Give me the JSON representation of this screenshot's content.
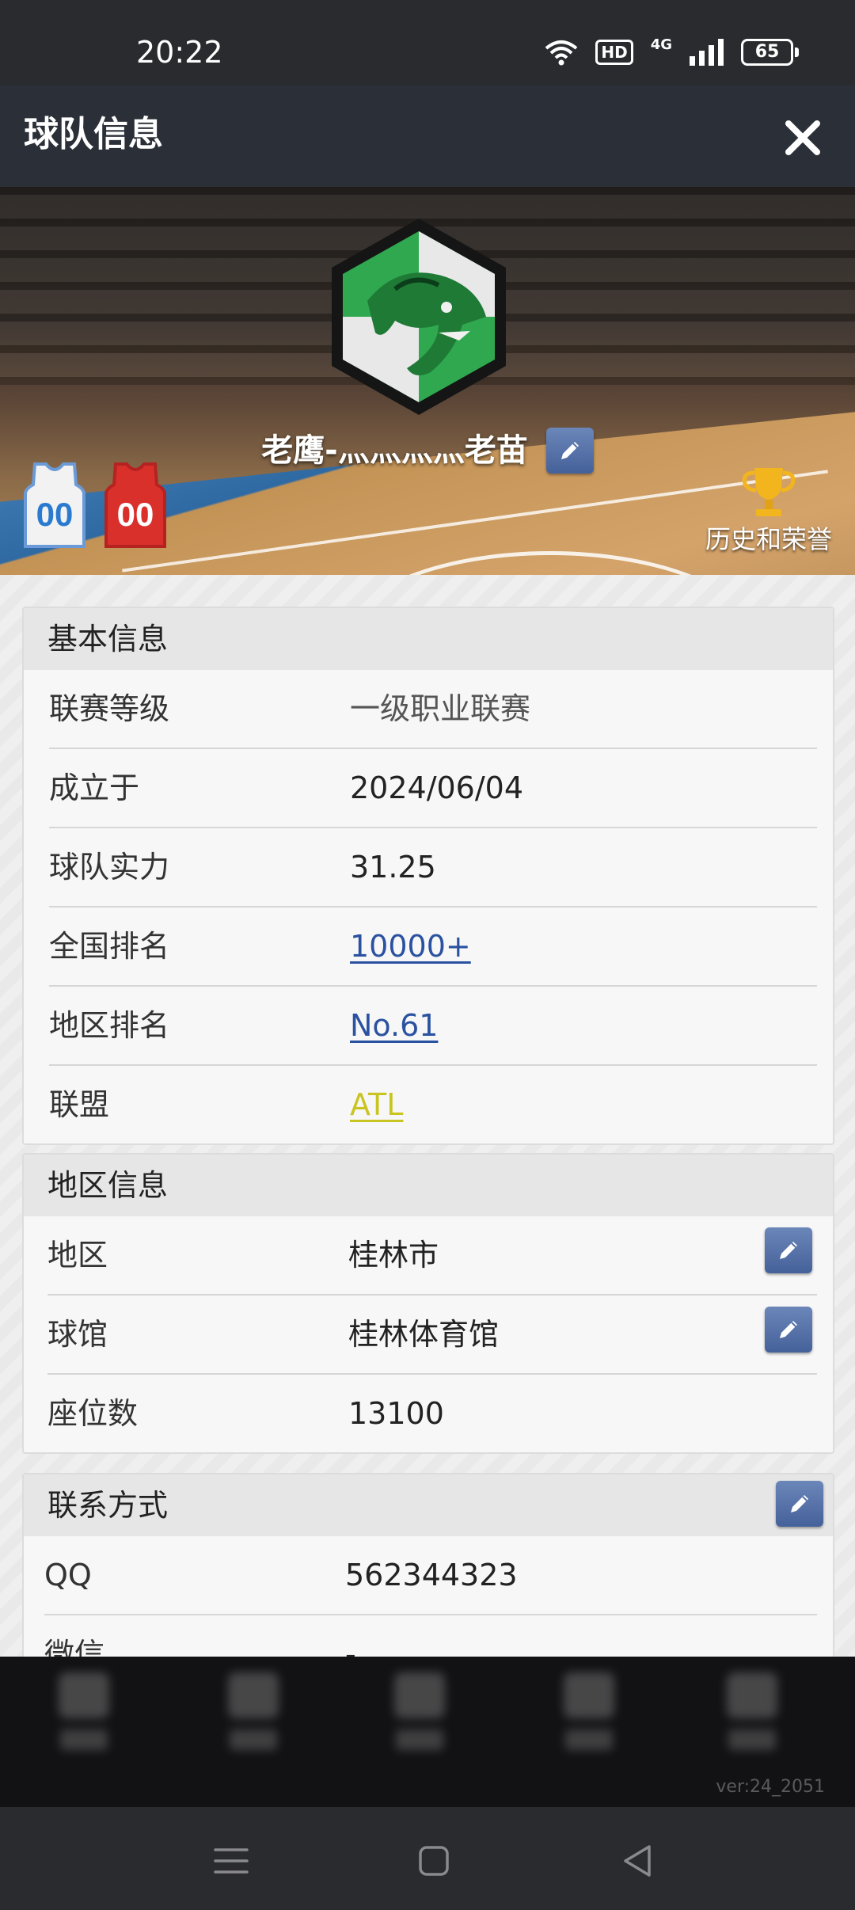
{
  "status_bar": {
    "time": "20:22",
    "hd": "HD",
    "network": "4G",
    "battery": "65"
  },
  "header": {
    "title": "球队信息",
    "close_icon": "close-icon"
  },
  "team": {
    "name": "老鹰-灬灬灬灬老苗",
    "home_jersey_number": "00",
    "away_jersey_number": "00",
    "honors_label": "历史和荣誉",
    "colors": {
      "logo_green": "#2fa84f",
      "home_jersey": "#f2f2f2",
      "away_jersey": "#d9302c",
      "edit_button": "#5570a8"
    }
  },
  "basic_info": {
    "title": "基本信息",
    "rows": [
      {
        "label": "联赛等级",
        "value": "一级职业联赛"
      },
      {
        "label": "成立于",
        "value": "2024/06/04"
      },
      {
        "label": "球队实力",
        "value": "31.25"
      },
      {
        "label": "全国排名",
        "value": "10000+"
      },
      {
        "label": "地区排名",
        "value": "No.61"
      },
      {
        "label": "联盟",
        "value": "ATL"
      }
    ]
  },
  "region_info": {
    "title": "地区信息",
    "rows": [
      {
        "label": "地区",
        "value": "桂林市"
      },
      {
        "label": "球馆",
        "value": "桂林体育馆"
      },
      {
        "label": "座位数",
        "value": "13100"
      }
    ]
  },
  "contact_info": {
    "title": "联系方式",
    "rows": [
      {
        "label": "QQ",
        "value": "562344323"
      },
      {
        "label": "微信",
        "value": "-"
      }
    ]
  },
  "footer": {
    "version": "ver:24_2051"
  }
}
